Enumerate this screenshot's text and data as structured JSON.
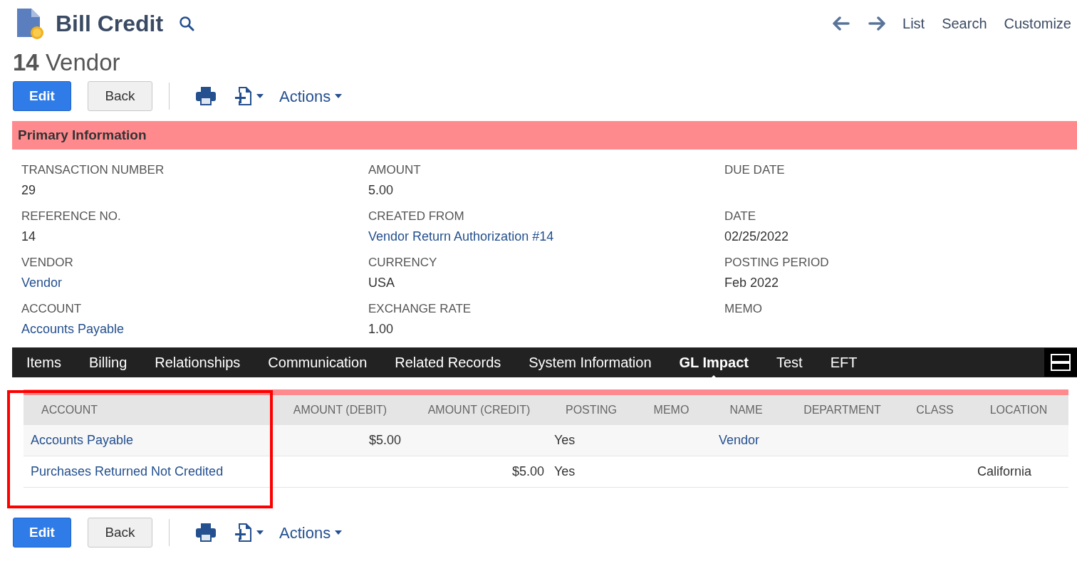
{
  "header": {
    "title": "Bill Credit",
    "record": "**14** Vendor",
    "nav": [
      "List",
      "Search",
      "Customize"
    ]
  },
  "toolbar": {
    "edit": "Edit",
    "back": "Back",
    "actions": "Actions"
  },
  "section": {
    "title": "Primary Information"
  },
  "fields": [
    {
      "label": "TRANSACTION NUMBER",
      "value": "29",
      "link": false
    },
    {
      "label": "AMOUNT",
      "value": "5.00",
      "link": false
    },
    {
      "label": "DUE DATE"
    },
    {
      "label": "REFERENCE NO.",
      "value": "14",
      "link": false
    },
    {
      "label": "CREATED FROM",
      "value": "Vendor Return Authorization #14",
      "link": true
    },
    {
      "label": "DATE",
      "value": "02/25/2022",
      "link": false
    },
    {
      "label": "VENDOR",
      "value": "Vendor",
      "link": true
    },
    {
      "label": "CURRENCY",
      "value": "USA",
      "link": false
    },
    {
      "label": "POSTING PERIOD",
      "value": "Feb 2022",
      "link": false
    },
    {
      "label": "ACCOUNT",
      "value": "Accounts Payable",
      "link": true
    },
    {
      "label": "EXCHANGE RATE",
      "value": "1.00",
      "link": false
    },
    {
      "label": "MEMO"
    }
  ],
  "tabs": [
    {
      "label": "Items",
      "selected": false
    },
    {
      "label": "Billing",
      "selected": false
    },
    {
      "label": "Relationships",
      "selected": false
    },
    {
      "label": "Communication",
      "selected": false
    },
    {
      "label": "Related Records",
      "selected": false
    },
    {
      "label": "System Information",
      "selected": false
    },
    {
      "label": "GL Impact",
      "selected": true
    },
    {
      "label": "Test",
      "selected": false
    },
    {
      "label": "EFT",
      "selected": false
    }
  ],
  "table": {
    "columns": [
      "ACCOUNT",
      "AMOUNT (DEBIT)",
      "AMOUNT (CREDIT)",
      "POSTING",
      "MEMO",
      "NAME",
      "DEPARTMENT",
      "CLASS",
      "LOCATION"
    ],
    "rows": [
      {
        "cells": [
          {
            "text": "Accounts Payable",
            "link": true
          },
          {
            "text": "$5.00",
            "link": false
          },
          null,
          {
            "text": "Yes",
            "link": false
          },
          null,
          {
            "text": "Vendor",
            "link": true
          },
          null,
          null,
          null
        ]
      },
      {
        "cells": [
          {
            "text": "Purchases Returned Not Credited",
            "link": true
          },
          null,
          {
            "text": "$5.00",
            "link": false
          },
          {
            "text": "Yes",
            "link": false
          },
          null,
          null,
          null,
          null,
          {
            "text": "California",
            "link": false
          }
        ]
      }
    ]
  },
  "bottom_toolbar": {
    "edit": "Edit",
    "back": "Back",
    "actions": "Actions"
  }
}
